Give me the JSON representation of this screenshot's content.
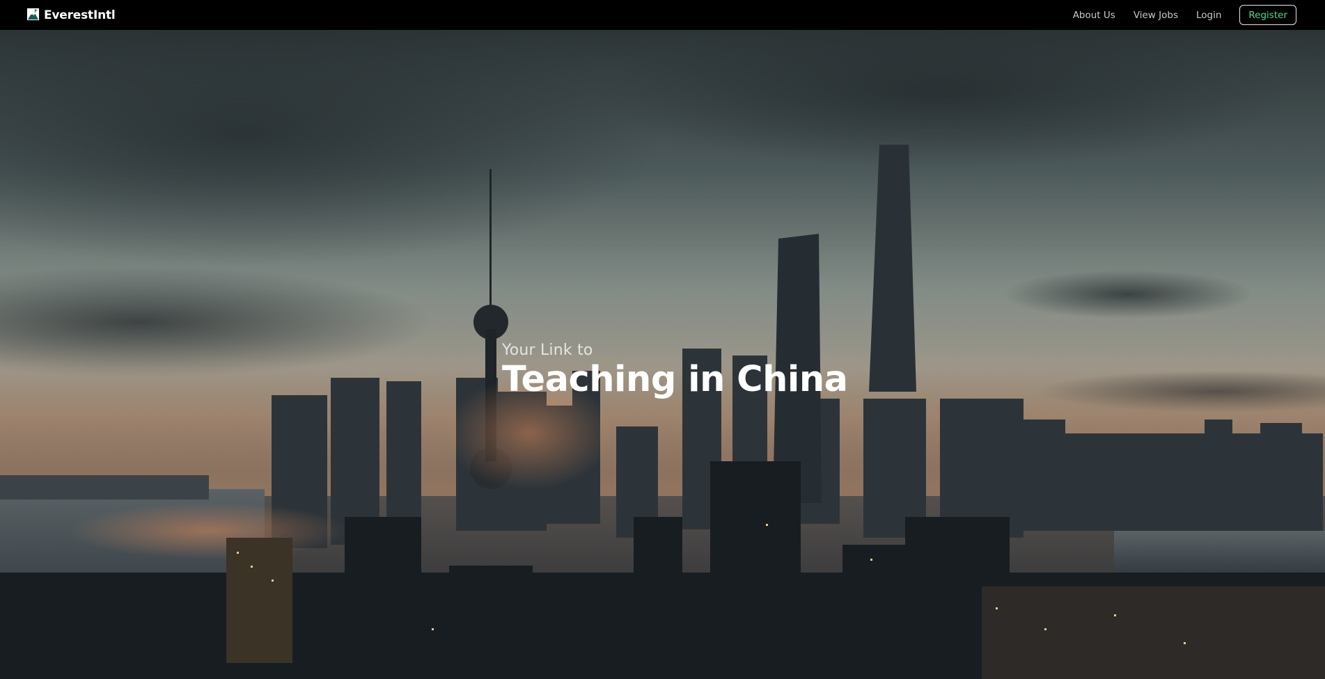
{
  "navbar": {
    "brand_name": "EverestIntl",
    "logo_icon": "mountain-flag-logo",
    "links": [
      {
        "label": "About Us"
      },
      {
        "label": "View Jobs"
      },
      {
        "label": "Login"
      }
    ],
    "register_label": "Register"
  },
  "hero": {
    "subtitle": "Your Link to",
    "title": "Teaching in China",
    "background": "shanghai-skyline-dusk"
  },
  "colors": {
    "navbar_bg": "#000000",
    "register_text": "#4cd98a",
    "register_border": "#e8e8e8",
    "nav_text": "#c9c9c9",
    "hero_text": "#ffffff"
  }
}
